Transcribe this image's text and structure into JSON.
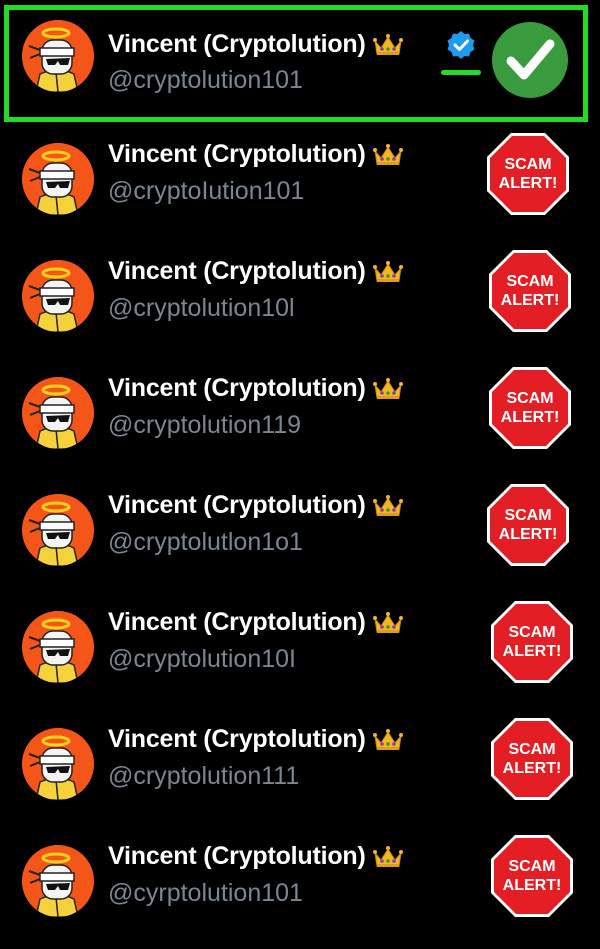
{
  "accounts": [
    {
      "name": "Vincent (Cryptolution)",
      "handle": "@cryptolution101",
      "verified": true,
      "status": "genuine",
      "badge_icon": "check-icon"
    },
    {
      "name": "Vincent (Cryptolution)",
      "handle": "@cryptoIution101",
      "verified": false,
      "status": "scam",
      "badge_text": [
        "SCAM",
        "ALERT!"
      ]
    },
    {
      "name": "Vincent (Cryptolution)",
      "handle": "@cryptolution10l",
      "verified": false,
      "status": "scam",
      "badge_text": [
        "SCAM",
        "ALERT!"
      ]
    },
    {
      "name": "Vincent (Cryptolution)",
      "handle": "@cryptolution119",
      "verified": false,
      "status": "scam",
      "badge_text": [
        "SCAM",
        "ALERT!"
      ]
    },
    {
      "name": "Vincent (Cryptolution)",
      "handle": "@cryptolutlon1o1",
      "verified": false,
      "status": "scam",
      "badge_text": [
        "SCAM",
        "ALERT!"
      ]
    },
    {
      "name": "Vincent (Cryptolution)",
      "handle": "@cryptolution10I",
      "verified": false,
      "status": "scam",
      "badge_text": [
        "SCAM",
        "ALERT!"
      ]
    },
    {
      "name": "Vincent (Cryptolution)",
      "handle": "@cryptolution111",
      "verified": false,
      "status": "scam",
      "badge_text": [
        "SCAM",
        "ALERT!"
      ]
    },
    {
      "name": "Vincent (Cryptolution)",
      "handle": "@cyrptolution101",
      "verified": false,
      "status": "scam",
      "badge_text": [
        "SCAM",
        "ALERT!"
      ]
    }
  ],
  "colors": {
    "background": "#000000",
    "highlight_border": "#22dd22",
    "name_text": "#ffffff",
    "handle_text": "#7c8690",
    "avatar_bg": "#f4561a",
    "verified_blue": "#1d9bf0",
    "check_green": "#3a9a3e",
    "stop_red": "#e31e24"
  }
}
